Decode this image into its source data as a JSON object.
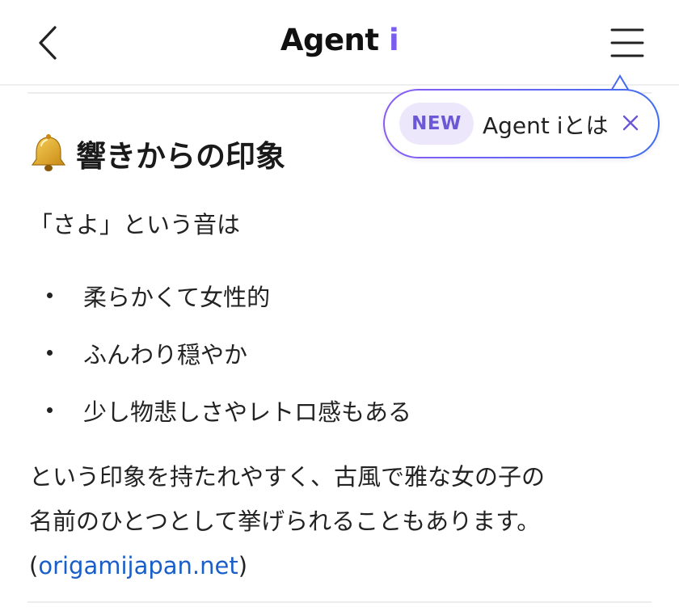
{
  "header": {
    "title_main": "Agent ",
    "title_accent": "i",
    "back_icon": "chevron-left-icon",
    "menu_icon": "hamburger-menu-icon"
  },
  "tooltip": {
    "badge": "NEW",
    "text": "Agent iとは",
    "close_icon": "close-icon"
  },
  "content": {
    "heading_icon": "bell-icon",
    "heading": "響きからの印象",
    "intro": "「さよ」という音は",
    "bullets": [
      "柔らかくて女性的",
      "ふんわり穏やか",
      "少し物悲しさやレトロ感もある"
    ],
    "paragraph_line1": "という印象を持たれやすく、古風で雅な女の子の",
    "paragraph_line2": "名前のひとつとして挙げられることもあります。",
    "source_open": "(",
    "source_link": "origamijapan.net",
    "source_close": ")"
  },
  "colors": {
    "accent": "#7b5cf0",
    "link": "#1a5fc9",
    "badge_bg": "#ece7fb",
    "badge_text": "#6b58d6"
  }
}
